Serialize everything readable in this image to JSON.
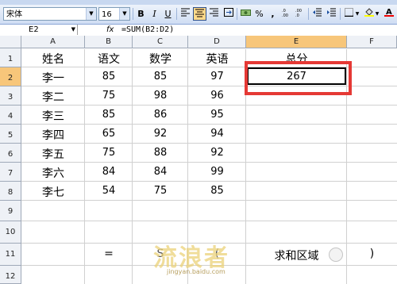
{
  "toolbar": {
    "font_name": "宋体",
    "font_size": "16",
    "bold": "B",
    "italic": "I",
    "underline": "U",
    "percent": "%",
    "comma": ","
  },
  "formula_bar": {
    "cell_ref": "E2",
    "fx": "fx",
    "formula": "=SUM(B2:D2)"
  },
  "columns": [
    "A",
    "B",
    "C",
    "D",
    "E",
    "F"
  ],
  "rows": [
    "1",
    "2",
    "3",
    "4",
    "5",
    "6",
    "7",
    "8",
    "9",
    "10",
    "11",
    "12"
  ],
  "header_row": [
    "姓名",
    "语文",
    "数学",
    "英语",
    "总分"
  ],
  "data_rows": [
    [
      "李一",
      "85",
      "85",
      "97",
      "267"
    ],
    [
      "李二",
      "75",
      "98",
      "96",
      ""
    ],
    [
      "李三",
      "85",
      "86",
      "95",
      ""
    ],
    [
      "李四",
      "65",
      "92",
      "94",
      ""
    ],
    [
      "李五",
      "75",
      "88",
      "92",
      ""
    ],
    [
      "李六",
      "84",
      "84",
      "99",
      ""
    ],
    [
      "李七",
      "54",
      "75",
      "85",
      ""
    ]
  ],
  "row11": {
    "b": "=",
    "c": "S",
    "d": "(",
    "e": "求和区域",
    "f": ")"
  },
  "watermark": {
    "text": "流浪者",
    "site": "jingyan.baidu.com"
  },
  "colors": {
    "highlight_box": "#e53935",
    "selected_header": "#f7c67a"
  }
}
